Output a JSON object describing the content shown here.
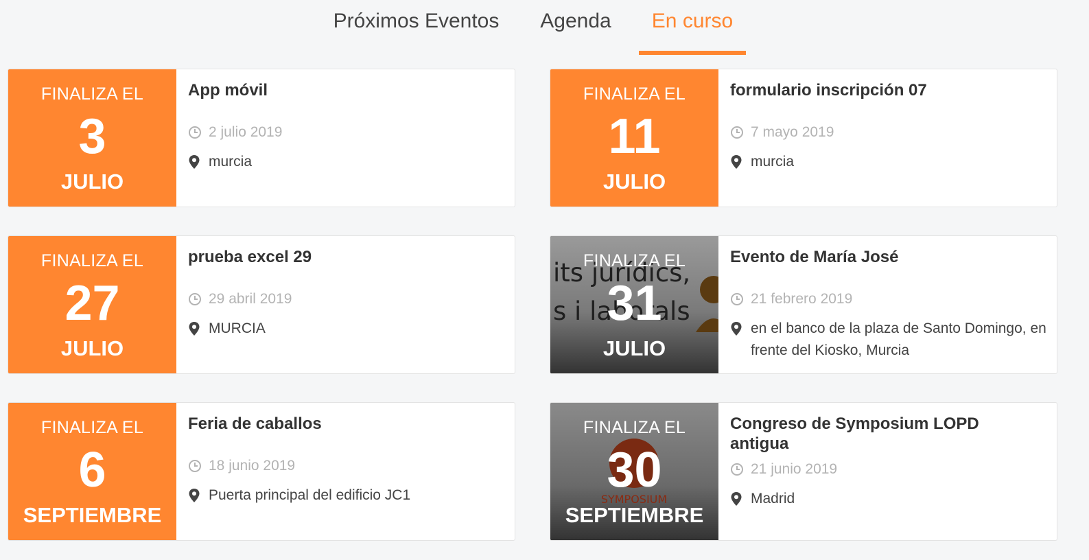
{
  "tabs": [
    {
      "label": "Próximos Eventos",
      "active": false
    },
    {
      "label": "Agenda",
      "active": false
    },
    {
      "label": "En curso",
      "active": true
    }
  ],
  "colors": {
    "accent": "#ff8630",
    "text": "#333333",
    "muted": "#b3b3b3"
  },
  "icons": {
    "time": "clock-icon",
    "place": "map-pin-icon"
  },
  "events": [
    {
      "ends_label": "FINALIZA EL",
      "day": "3",
      "month": "JULIO",
      "title": "App móvil",
      "date": "2 julio 2019",
      "place": "murcia",
      "image": false
    },
    {
      "ends_label": "FINALIZA EL",
      "day": "11",
      "month": "JULIO",
      "title": "formulario inscripción 07",
      "date": "7 mayo 2019",
      "place": "murcia",
      "image": false
    },
    {
      "ends_label": "FINALIZA EL",
      "day": "27",
      "month": "JULIO",
      "title": "prueba excel 29",
      "date": "29 abril 2019",
      "place": "MURCIA",
      "image": false
    },
    {
      "ends_label": "FINALIZA EL",
      "day": "31",
      "month": "JULIO",
      "title": "Evento de María José",
      "date": "21 febrero 2019",
      "place": "en el banco de la plaza de Santo Domingo, en frente del Kiosko, Murcia",
      "image": true,
      "image_text": [
        "its jurídics,",
        "s i laborals"
      ]
    },
    {
      "ends_label": "FINALIZA EL",
      "day": "6",
      "month": "SEPTIEMBRE",
      "title": "Feria de caballos",
      "date": "18 junio 2019",
      "place": "Puerta principal del edificio JC1",
      "image": false
    },
    {
      "ends_label": "FINALIZA EL",
      "day": "30",
      "month": "SEPTIEMBRE",
      "title": "Congreso de Symposium LOPD antigua",
      "date": "21 junio 2019",
      "place": "Madrid",
      "image": true,
      "image_text": [
        "SYMPOSIUM"
      ]
    }
  ]
}
